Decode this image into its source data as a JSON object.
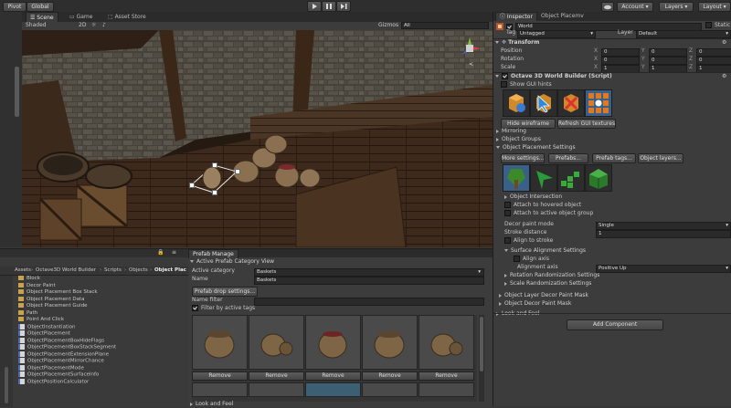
{
  "toolbar": {
    "pivot_label": "Pivot",
    "global_label": "Global",
    "play_icon": "play-icon",
    "pause_icon": "pause-icon",
    "step_icon": "step-icon",
    "account_label": "Account",
    "layers_label": "Layers",
    "layout_label": "Layout"
  },
  "scene": {
    "tabs": [
      "Scene",
      "Game",
      "Asset Store"
    ],
    "shading_mode": "Shaded",
    "mode_2d": "2D",
    "gizmos_label": "Gizmos",
    "search_placeholder": "All",
    "gizmo_persp_label": "<"
  },
  "inspector": {
    "tabs": [
      "Inspector",
      "Object Placemv"
    ],
    "object_name": "World",
    "static_label": "Static",
    "tag_label": "Tag",
    "tag_value": "Untagged",
    "layer_label": "Layer",
    "layer_value": "Default",
    "transform_title": "Transform",
    "position_label": "Position",
    "rotation_label": "Rotation",
    "scale_label": "Scale",
    "position": {
      "x": "0",
      "y": "0",
      "z": "0"
    },
    "rotation": {
      "x": "0",
      "y": "0",
      "z": "0"
    },
    "scale": {
      "x": "1",
      "y": "1",
      "z": "1"
    },
    "script_title": "Octave 3D World Builder (Script)",
    "show_gui_hints": "Show GUI hints",
    "hide_wireframe": "Hide wireframe",
    "refresh_gui_textures": "Refresh GUI textures",
    "mirroring": "Mirroring",
    "object_groups": "Object Groups",
    "placement_settings": "Object Placement Settings",
    "more_settings": "More settings...",
    "prefabs": "Prefabs...",
    "prefab_tags": "Prefab tags...",
    "object_layers": "Object layers...",
    "object_intersection": "Object Intersection",
    "attach_hovered": "Attach to hovered object",
    "attach_active_group": "Attach to active object group",
    "decor_paint_mode_label": "Decor paint mode",
    "decor_paint_mode_value": "Single",
    "stroke_distance_label": "Stroke distance",
    "stroke_distance_value": "1",
    "align_to_stroke": "Align to stroke",
    "surface_alignment": "Surface Alignment Settings",
    "align_axis": "Align axis",
    "alignment_axis_label": "Alignment axis",
    "alignment_axis_value": "Positive Up",
    "rotation_randomization": "Rotation Randomization Settings",
    "scale_randomization": "Scale Randomization Settings",
    "layer_decor_paint_mask": "Object Layer Decor Paint Mask",
    "decor_paint_mask": "Object Decor Paint Mask",
    "look_and_feel": "Look and Feel",
    "add_component": "Add Component"
  },
  "project": {
    "breadcrumb": [
      "Assets",
      "Octave3D World Builder",
      "Scripts",
      "Objects",
      "Object Plac"
    ],
    "items": [
      {
        "name": "Block",
        "kind": "folder"
      },
      {
        "name": "Decor Paint",
        "kind": "folder"
      },
      {
        "name": "Object Placement Box Stack",
        "kind": "folder"
      },
      {
        "name": "Object Placement Data",
        "kind": "folder"
      },
      {
        "name": "Object Placement Guide",
        "kind": "folder"
      },
      {
        "name": "Path",
        "kind": "folder"
      },
      {
        "name": "Point And Click",
        "kind": "folder"
      },
      {
        "name": "ObjectInstantiation",
        "kind": "script"
      },
      {
        "name": "ObjectPlacement",
        "kind": "script"
      },
      {
        "name": "ObjectPlacementBoxHideFlags",
        "kind": "script"
      },
      {
        "name": "ObjectPlacementBoxStackSegment",
        "kind": "script"
      },
      {
        "name": "ObjectPlacementExtensionPlane",
        "kind": "script"
      },
      {
        "name": "ObjectPlacementMirrorChance",
        "kind": "script"
      },
      {
        "name": "ObjectPlacementMode",
        "kind": "script"
      },
      {
        "name": "ObjectPlacementSurfaceInfo",
        "kind": "script"
      },
      {
        "name": "ObjectPositionCalculator",
        "kind": "script"
      }
    ]
  },
  "prefab_manager": {
    "tab": "Prefab Manage",
    "view_header": "Active Prefab Category View",
    "active_category_label": "Active category",
    "active_category_value": "Baskets",
    "name_label": "Name",
    "name_value": "Baskets",
    "prefab_drop_settings": "Prefab drop settings...",
    "name_filter_label": "Name filter",
    "filter_by_tags": "Filter by active tags",
    "remove_label": "Remove",
    "look_and_feel": "Look and Feel"
  },
  "colors": {
    "background": "#383838",
    "panel": "#3c3c3c",
    "accent": "#3e6ea8",
    "selection": "#2f5f8a"
  }
}
